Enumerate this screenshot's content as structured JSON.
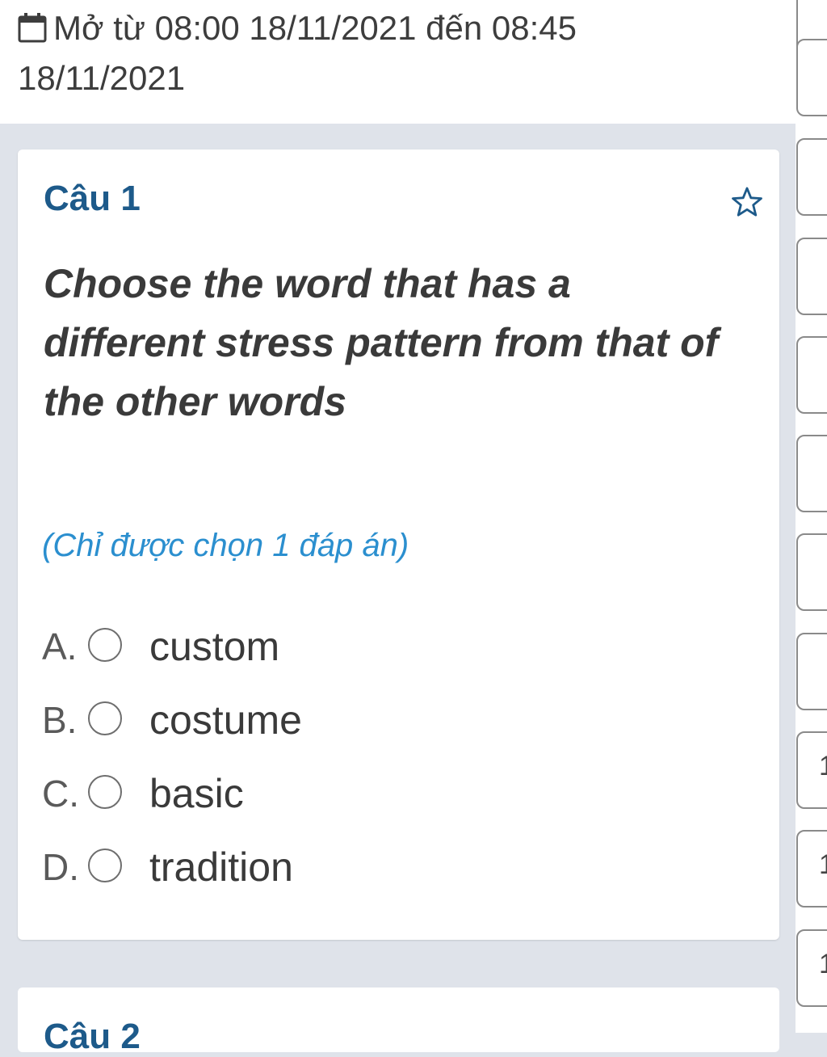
{
  "schedule": {
    "icon": "calendar-icon",
    "text": "Mở từ 08:00 18/11/2021 đến 08:45 18/11/2021"
  },
  "question": {
    "title": "Câu 1",
    "star_icon": "star-outline-icon",
    "text": "Choose the word that has a different stress pattern from that of the other words",
    "hint": "(Chỉ được chọn 1 đáp án)",
    "options": [
      {
        "letter": "A.",
        "text": "custom"
      },
      {
        "letter": "B.",
        "text": "costume"
      },
      {
        "letter": "C.",
        "text": "basic"
      },
      {
        "letter": "D.",
        "text": "tradition"
      }
    ]
  },
  "next_question": {
    "title": "Câu 2"
  },
  "question_nav": {
    "items": [
      "",
      "",
      "",
      "",
      "",
      "",
      "",
      "1",
      "1",
      "1"
    ]
  },
  "colors": {
    "accent": "#1d5a8a",
    "hint": "#2b8fcf",
    "background": "#dfe3ea"
  }
}
